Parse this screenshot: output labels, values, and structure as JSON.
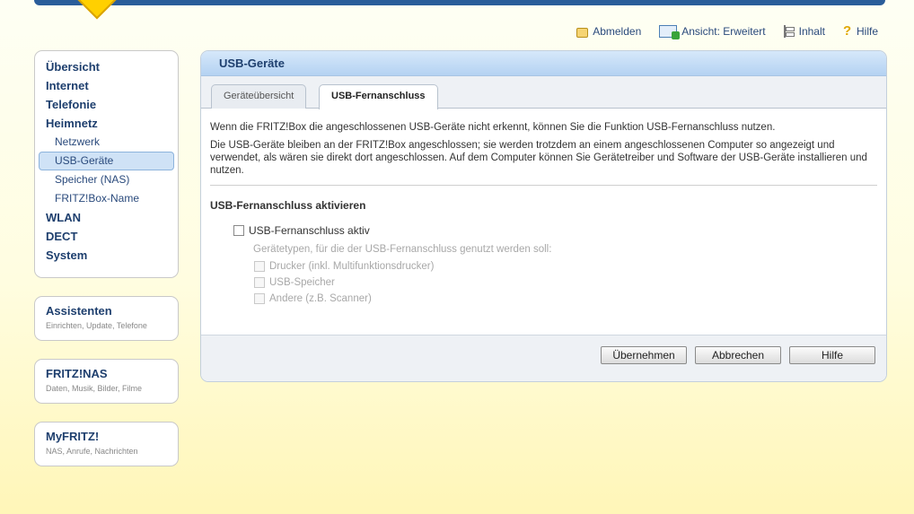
{
  "header": {
    "logout_label": "Abmelden",
    "view_label": "Ansicht: Erweitert",
    "contents_label": "Inhalt",
    "help_label": "Hilfe"
  },
  "sidebar": {
    "items": [
      {
        "label": "Übersicht"
      },
      {
        "label": "Internet"
      },
      {
        "label": "Telefonie"
      },
      {
        "label": "Heimnetz"
      },
      {
        "label": "Netzwerk"
      },
      {
        "label": "USB-Geräte"
      },
      {
        "label": "Speicher (NAS)"
      },
      {
        "label": "FRITZ!Box-Name"
      },
      {
        "label": "WLAN"
      },
      {
        "label": "DECT"
      },
      {
        "label": "System"
      }
    ],
    "cards": [
      {
        "title": "Assistenten",
        "subtitle": "Einrichten, Update, Telefone"
      },
      {
        "title": "FRITZ!NAS",
        "subtitle": "Daten, Musik, Bilder, Filme"
      },
      {
        "title": "MyFRITZ!",
        "subtitle": "NAS, Anrufe, Nachrichten"
      }
    ]
  },
  "panel": {
    "title": "USB-Geräte",
    "tabs": [
      {
        "label": "Geräteübersicht"
      },
      {
        "label": "USB-Fernanschluss"
      }
    ],
    "intro_1": "Wenn die FRITZ!Box die angeschlossenen USB-Geräte nicht erkennt, können Sie die Funktion USB-Fernanschluss nutzen.",
    "intro_2": "Die USB-Geräte bleiben an der FRITZ!Box angeschlossen; sie werden trotzdem an einem angeschlossenen Computer so angezeigt und verwendet, als wären sie direkt dort angeschlossen. Auf dem Computer können Sie Gerätetreiber und Software der USB-Geräte installieren und nutzen.",
    "section_title": "USB-Fernanschluss aktivieren",
    "main_checkbox_label": "USB-Fernanschluss aktiv",
    "hint": "Gerätetypen, für die der USB-Fernanschluss genutzt werden soll:",
    "device_options": [
      {
        "label": "Drucker (inkl. Multifunktionsdrucker)"
      },
      {
        "label": "USB-Speicher"
      },
      {
        "label": "Andere (z.B. Scanner)"
      }
    ],
    "buttons": {
      "apply": "Übernehmen",
      "cancel": "Abbrechen",
      "help": "Hilfe"
    }
  }
}
